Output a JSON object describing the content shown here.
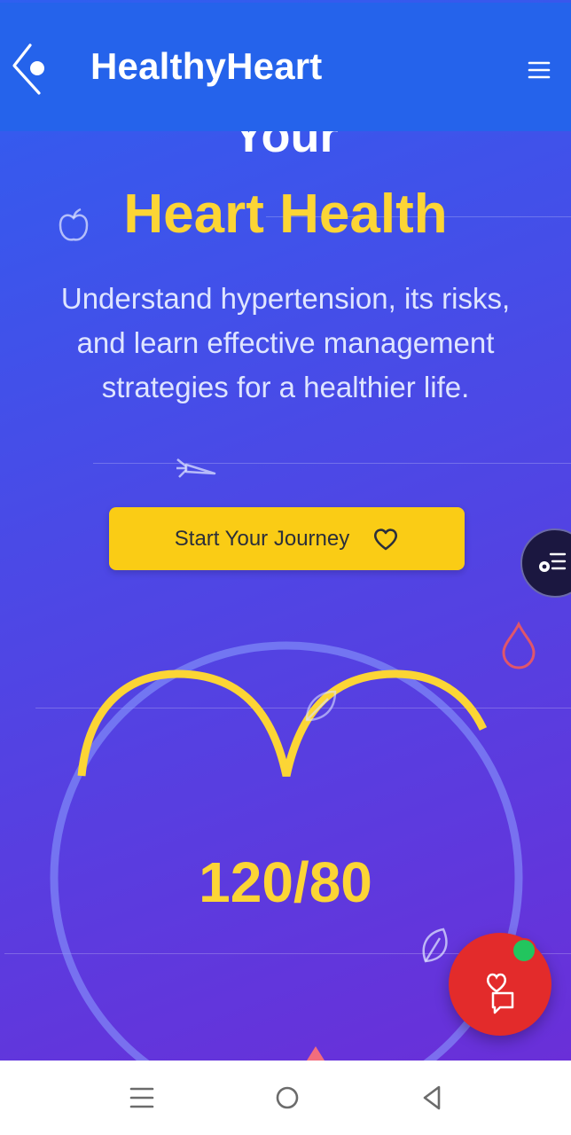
{
  "app": {
    "brand": "HealthyHeart"
  },
  "hero": {
    "title_partial": "Your",
    "title_accent": "Heart Health",
    "subtitle": "Understand hypertension, its risks, and learn effective management strategies for a healthier life.",
    "cta_label": "Start Your Journey"
  },
  "gauge": {
    "reading": "120/80"
  },
  "colors": {
    "header": "#2563eb",
    "accent": "#facc15",
    "fab": "#e32b2b",
    "online": "#22c55e"
  },
  "icons": [
    "back-icon",
    "menu-icon",
    "heart-icon",
    "apple-icon",
    "carrot-icon",
    "droplet-icon",
    "leaf-icon",
    "chat-heart-icon",
    "filter-list-icon",
    "nav-menu-icon",
    "nav-home-icon",
    "nav-back-icon"
  ]
}
